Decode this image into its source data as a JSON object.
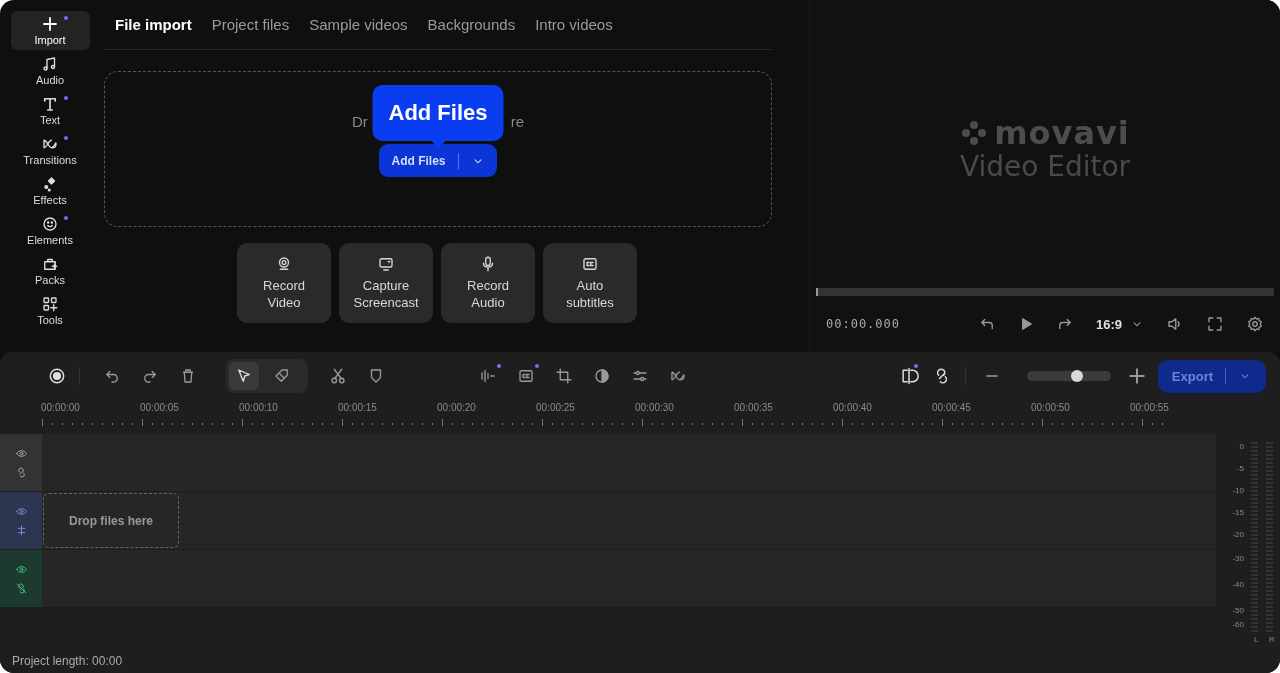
{
  "sidebar": {
    "items": [
      {
        "label": "Import",
        "selected": true,
        "new": true
      },
      {
        "label": "Audio",
        "selected": false,
        "new": false
      },
      {
        "label": "Text",
        "selected": false,
        "new": true
      },
      {
        "label": "Transitions",
        "selected": false,
        "new": true
      },
      {
        "label": "Effects",
        "selected": false,
        "new": false
      },
      {
        "label": "Elements",
        "selected": false,
        "new": true
      },
      {
        "label": "Packs",
        "selected": false,
        "new": false
      },
      {
        "label": "Tools",
        "selected": false,
        "new": false
      }
    ]
  },
  "tabs": [
    {
      "label": "File import",
      "selected": true
    },
    {
      "label": "Project files",
      "selected": false
    },
    {
      "label": "Sample videos",
      "selected": false
    },
    {
      "label": "Backgrounds",
      "selected": false
    },
    {
      "label": "Intro videos",
      "selected": false
    }
  ],
  "drop_zone": {
    "hint_start": "Dr",
    "hint_end": "re",
    "button": "Add Files",
    "tooltip": "Add Files"
  },
  "actions": [
    {
      "label": "Record\nVideo"
    },
    {
      "label": "Capture\nScreencast"
    },
    {
      "label": "Record\nAudio"
    },
    {
      "label": "Auto\nsubtitles"
    }
  ],
  "preview": {
    "logo": "movavi",
    "subtitle": "Video Editor",
    "level": 0,
    "time": "00:00.000",
    "aspect": "16:9"
  },
  "toolbar": {
    "tools": [
      {
        "selected": false,
        "new": false
      },
      {
        "selected": false,
        "new": false
      },
      {
        "selected": false,
        "new": false
      },
      {
        "selected": true,
        "new": false
      },
      {
        "selected": false,
        "new": false
      },
      {
        "selected": false,
        "new": false
      },
      {
        "selected": false,
        "new": false
      },
      {
        "selected": false,
        "new": true
      },
      {
        "selected": false,
        "new": true
      },
      {
        "selected": false,
        "new": false
      },
      {
        "selected": false,
        "new": false
      },
      {
        "selected": false,
        "new": false
      },
      {
        "selected": false,
        "new": false
      }
    ],
    "zoom": {
      "level": 0.6
    },
    "export": "Export"
  },
  "ruler": [
    "00:00:00",
    "00:00:05",
    "00:00:10",
    "00:00:15",
    "00:00:20",
    "00:00:25",
    "00:00:30",
    "00:00:35",
    "00:00:40",
    "00:00:45",
    "00:00:50",
    "00:00:55"
  ],
  "tracks": [
    {
      "kind": "title"
    },
    {
      "kind": "video",
      "placeholder": "Drop files here"
    },
    {
      "kind": "audio"
    }
  ],
  "meter": {
    "scale": [
      "0",
      "-5",
      "-10",
      "-15",
      "-20",
      "-30",
      "-40",
      "-50",
      "-60"
    ],
    "channels": [
      "L",
      "R"
    ]
  },
  "status_bar": "Project length: 00:00"
}
